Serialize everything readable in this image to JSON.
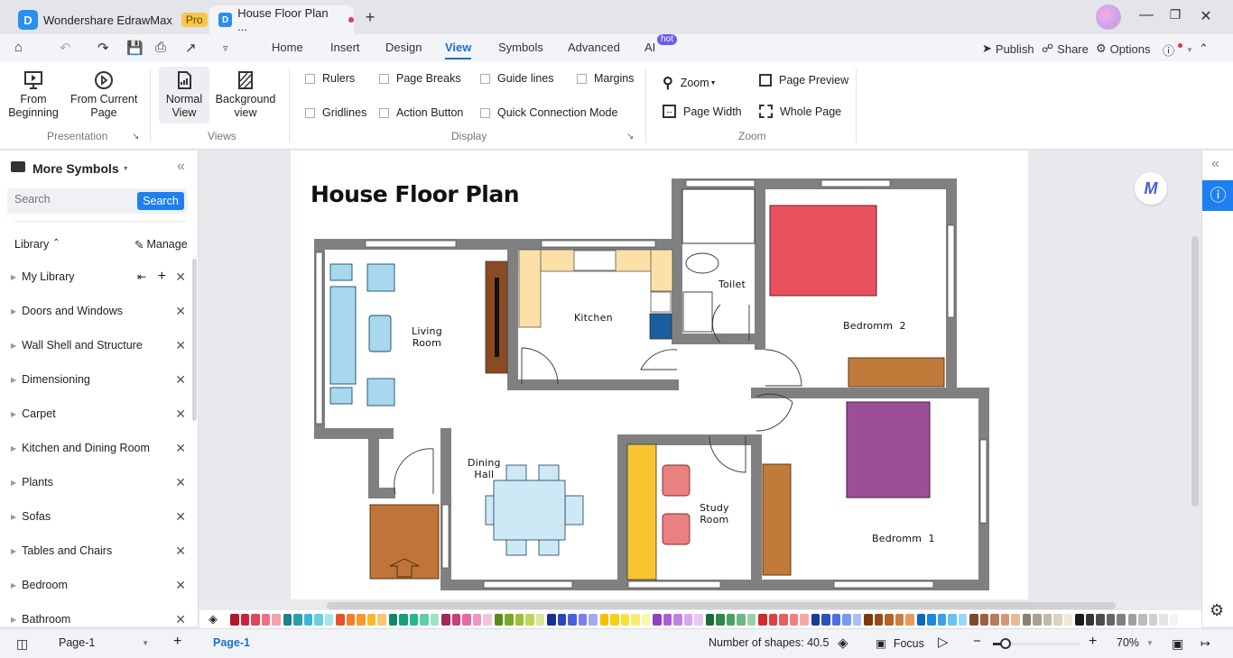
{
  "app": {
    "name": "Wondershare EdrawMax",
    "badge": "Pro",
    "doc_tab": "House Floor Plan ...",
    "new_tab": "+"
  },
  "menu": {
    "tabs": [
      "Home",
      "Insert",
      "Design",
      "View",
      "Symbols",
      "Advanced",
      "AI"
    ],
    "active": "View",
    "ai_badge": "hot",
    "right": {
      "publish": "Publish",
      "share": "Share",
      "options": "Options"
    }
  },
  "ribbon": {
    "presentation": {
      "from_beginning": "From\nBeginning",
      "from_current": "From Current\nPage",
      "group": "Presentation"
    },
    "views": {
      "normal": "Normal\nView",
      "background": "Background\nview",
      "group": "Views"
    },
    "display": {
      "checks": [
        {
          "label": "Rulers",
          "checked": false
        },
        {
          "label": "Page Breaks",
          "checked": false
        },
        {
          "label": "Guide lines",
          "checked": false
        },
        {
          "label": "Margins",
          "checked": false
        },
        {
          "label": "Gridlines",
          "checked": false
        },
        {
          "label": "Action Button",
          "checked": false
        },
        {
          "label": "Quick Connection Mode",
          "checked": false
        }
      ],
      "group": "Display"
    },
    "zoom": {
      "zoom": "Zoom",
      "page_preview": "Page Preview",
      "page_width": "Page Width",
      "whole_page": "Whole Page",
      "group": "Zoom"
    }
  },
  "sidebar": {
    "title": "More Symbols",
    "search_placeholder": "Search",
    "search_button": "Search",
    "library_label": "Library",
    "manage_label": "Manage",
    "items": [
      "My Library",
      "Doors and Windows",
      "Wall Shell and Structure",
      "Dimensioning",
      "Carpet",
      "Kitchen and Dining Room",
      "Plants",
      "Sofas",
      "Tables and Chairs",
      "Bedroom",
      "Bathroom"
    ]
  },
  "diagram": {
    "title": "House Floor Plan",
    "rooms": {
      "living": "Living\nRoom",
      "kitchen": "Kitchen",
      "toilet": "Toilet",
      "bedroom2": "Bedromm  2",
      "dining": "Dining\nHall",
      "study": "Study\nRoom",
      "bedroom1": "Bedromm  1"
    },
    "colors": {
      "wall": "#808080",
      "sofa": "#a8d8ee",
      "tv_unit": "#8b4a22",
      "counter": "#fde0a8",
      "sink": "#1a5e9e",
      "bed2": "#e8505e",
      "bed1": "#9b4f96",
      "wardrobe": "#c07a3a",
      "desk": "#f7c530",
      "chair": "#ea8080",
      "table": "#cde9f6",
      "stairs": "#c0743a"
    }
  },
  "palette": [
    "#b3162a",
    "#d31f3a",
    "#e0455a",
    "#ef7085",
    "#f4a0ad",
    "#1e7f8f",
    "#2a9fb0",
    "#3ab6d5",
    "#66cfe0",
    "#a8e6ef",
    "#e8542a",
    "#f57c2a",
    "#f9992a",
    "#f9b52a",
    "#f8c670",
    "#12876a",
    "#17a077",
    "#20b890",
    "#5ccfaa",
    "#9ee3c9",
    "#a3275a",
    "#c9407a",
    "#e66aa4",
    "#f293c0",
    "#f3c4d9",
    "#5a8a1a",
    "#7aa62a",
    "#9cbe3a",
    "#bcd65a",
    "#d8e6a0",
    "#1a2f8f",
    "#2b45c0",
    "#4a5fe0",
    "#7a80f0",
    "#a7a8f4",
    "#f5c200",
    "#f8d10d",
    "#f8df3a",
    "#faec70",
    "#fcf6a8",
    "#9040c0",
    "#a860d8",
    "#c080e8",
    "#d8a8f0",
    "#e8c8f6",
    "#1a6a3a",
    "#2a8a4a",
    "#4aa066",
    "#6ab884",
    "#9ad0a6",
    "#d02a2a",
    "#e04040",
    "#ea6060",
    "#f28080",
    "#f6a8a8",
    "#1a3a9a",
    "#2a52c0",
    "#4a72e0",
    "#7a9af0",
    "#a8c0f6",
    "#7a3a0a",
    "#9a4a1a",
    "#b8602a",
    "#d07a40",
    "#e89a60",
    "#0a6ac0",
    "#1a88e0",
    "#3aa0ea",
    "#6ac0f2",
    "#9ad8f8",
    "#7a4a2a",
    "#9a6040",
    "#b87a5a",
    "#d09878",
    "#e8b898",
    "#8a8070",
    "#a8a090",
    "#c0bca8",
    "#d8d4c0",
    "#ece8d8",
    "#1a1a1a",
    "#333333",
    "#4d4d4d",
    "#666666",
    "#808080",
    "#a0a0a0",
    "#bcbcbc",
    "#d0d0d0",
    "#e4e4e4",
    "#f4f4f4"
  ],
  "status": {
    "page_select": "Page-1",
    "page_tab": "Page-1",
    "shapes": "Number of shapes: 40.5",
    "focus": "Focus",
    "zoom_level": "70%",
    "zoom_fraction": 0.08
  }
}
